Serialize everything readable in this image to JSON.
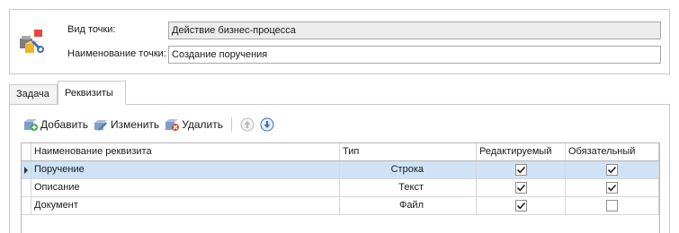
{
  "header": {
    "point_type_label": "Вид точки:",
    "point_type_value": "Действие бизнес-процесса",
    "point_name_label": "Наименование точки:",
    "point_name_value": "Создание поручения"
  },
  "tabs": [
    {
      "label": "Задача",
      "active": false
    },
    {
      "label": "Реквизиты",
      "active": true
    }
  ],
  "toolbar": {
    "add_label": "Добавить",
    "edit_label": "Изменить",
    "delete_label": "Удалить"
  },
  "grid": {
    "columns": [
      "Наименование реквизита",
      "Тип",
      "Редактируемый",
      "Обязательный"
    ],
    "rows": [
      {
        "name": "Поручение",
        "type": "Строка",
        "editable": true,
        "required": true,
        "selected": true
      },
      {
        "name": "Описание",
        "type": "Текст",
        "editable": true,
        "required": true,
        "selected": false
      },
      {
        "name": "Документ",
        "type": "Файл",
        "editable": true,
        "required": false,
        "selected": false
      }
    ]
  },
  "colors": {
    "selection": "#cfe3f5",
    "border": "#c9c9c9",
    "readonly_field": "#ececec"
  }
}
